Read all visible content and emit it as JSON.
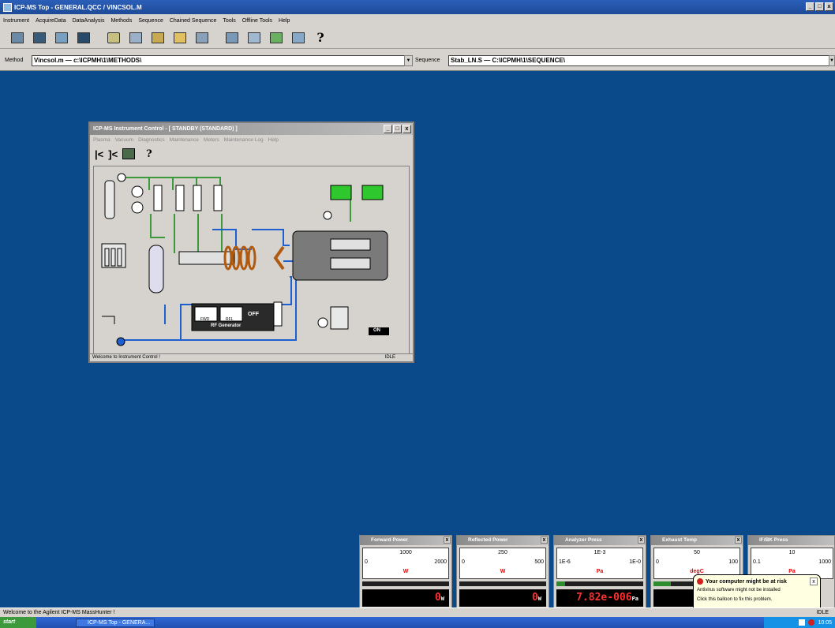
{
  "window": {
    "title": "ICP-MS Top - GENERAL.QCC / VINCSOL.M",
    "controls": [
      "_",
      "□",
      "x"
    ]
  },
  "menu": [
    "Instrument",
    "AcquireData",
    "DataAnalysis",
    "Methods",
    "Sequence",
    "Chained Sequence",
    "Tools",
    "Offline Tools",
    "Help"
  ],
  "toolbar": {
    "help_label": "?"
  },
  "method_bar": {
    "method_label": "Method",
    "method_value": "Vincsol.m  —  c:\\ICPMH\\1\\METHODS\\",
    "sequence_label": "Sequence",
    "sequence_value": "Stab_LN.S  —  C:\\ICPMH\\1\\SEQUENCE\\"
  },
  "instrument_control": {
    "title": "ICP-MS Instrument Control - [ STANDBY (STANDARD) ]",
    "menu": [
      "Plasma",
      "Vacuum",
      "Diagnostics",
      "Maintenance",
      "Meters",
      "Maintenance Log",
      "Help"
    ],
    "toolbar_help": "?",
    "rf_generator_label": "RF Generator",
    "fwd_label": "FWD",
    "rfl_label": "RFL",
    "rf_state": "OFF",
    "pump_state": "ON",
    "status_text": "Welcome to Instrument Control !",
    "status_right": "IDLE"
  },
  "meters": [
    {
      "title": "Forward Power",
      "scale_left": "0",
      "scale_center": "1000",
      "scale_right": "2000",
      "unit": "W",
      "digits": "0",
      "digit_unit": "W"
    },
    {
      "title": "Reflected Power",
      "scale_left": "0",
      "scale_center": "250",
      "scale_right": "500",
      "unit": "W",
      "digits": "0",
      "digit_unit": "W"
    },
    {
      "title": "Analyzer Press",
      "scale_left": "1E-6",
      "scale_center": "1E-3",
      "scale_right": "1E-0",
      "unit": "Pa",
      "digits": "7.82e-006",
      "digit_unit": "Pa"
    },
    {
      "title": "Exhaust Temp",
      "scale_left": "0",
      "scale_center": "50",
      "scale_right": "100",
      "unit": "degC",
      "digits": "",
      "digit_unit": ""
    },
    {
      "title": "IF/BK Press",
      "scale_left": "0.1",
      "scale_center": "10",
      "scale_right": "1000",
      "unit": "Pa",
      "digits": "",
      "digit_unit": ""
    }
  ],
  "status": {
    "text": "Welcome to the Agilent ICP-MS MassHunter !",
    "right": "IDLE"
  },
  "taskbar": {
    "start_label": "start",
    "task_item": "ICP-MS Top - GENERA...",
    "clock": "10:05"
  },
  "balloon": {
    "title": "Your computer might be at risk",
    "line1": "Antivirus software might not be installed",
    "line2": "Click this balloon to fix this problem."
  }
}
